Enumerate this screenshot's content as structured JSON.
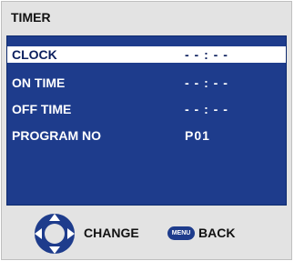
{
  "title": "TIMER",
  "rows": [
    {
      "label": "CLOCK",
      "value": "- - : - -",
      "selected": true
    },
    {
      "label": "ON TIME",
      "value": "- - : - -",
      "selected": false
    },
    {
      "label": "OFF TIME",
      "value": "- - : - -",
      "selected": false
    },
    {
      "label": "PROGRAM NO",
      "value": "P01",
      "selected": false
    }
  ],
  "footer": {
    "change_label": "CHANGE",
    "menu_icon_text": "MENU",
    "back_label": "BACK"
  },
  "colors": {
    "panel": "#1e3c8c",
    "frame": "#e3e3e3",
    "selected_bg": "#ffffff"
  }
}
